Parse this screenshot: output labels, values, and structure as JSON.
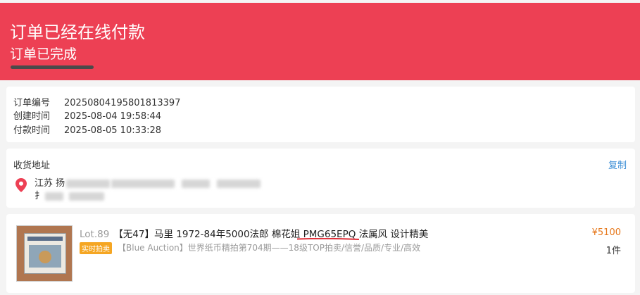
{
  "header": {
    "title": "订单已经在线付款",
    "subtitle": "订单已完成"
  },
  "order_info": {
    "rows": [
      {
        "label": "订单编号",
        "value": "20250804195801813397"
      },
      {
        "label": "创建时间",
        "value": "2025-08-04 19:58:44"
      },
      {
        "label": "付款时间",
        "value": "2025-08-05 10:33:28"
      }
    ]
  },
  "address": {
    "label": "收货地址",
    "copy_label": "复制",
    "line1_visible": "江苏 扬",
    "line2_visible": "扌",
    "icon": "location-pin-icon"
  },
  "product": {
    "lot": "Lot.89",
    "title": "【无47】马里 1972-84年5000法郎 棉花姐 PMG65EPQ 法属风 设计精美",
    "badge": "实时拍卖",
    "shop": "【Blue Auction】世界纸币精拍第704期——18级TOP拍卖/信誉/品质/专业/高效",
    "price": "¥5100",
    "quantity": "1件"
  },
  "colors": {
    "header_bg": "#ed4054",
    "price": "#e6771a",
    "link": "#3b8ed6",
    "badge": "#f5a623"
  }
}
